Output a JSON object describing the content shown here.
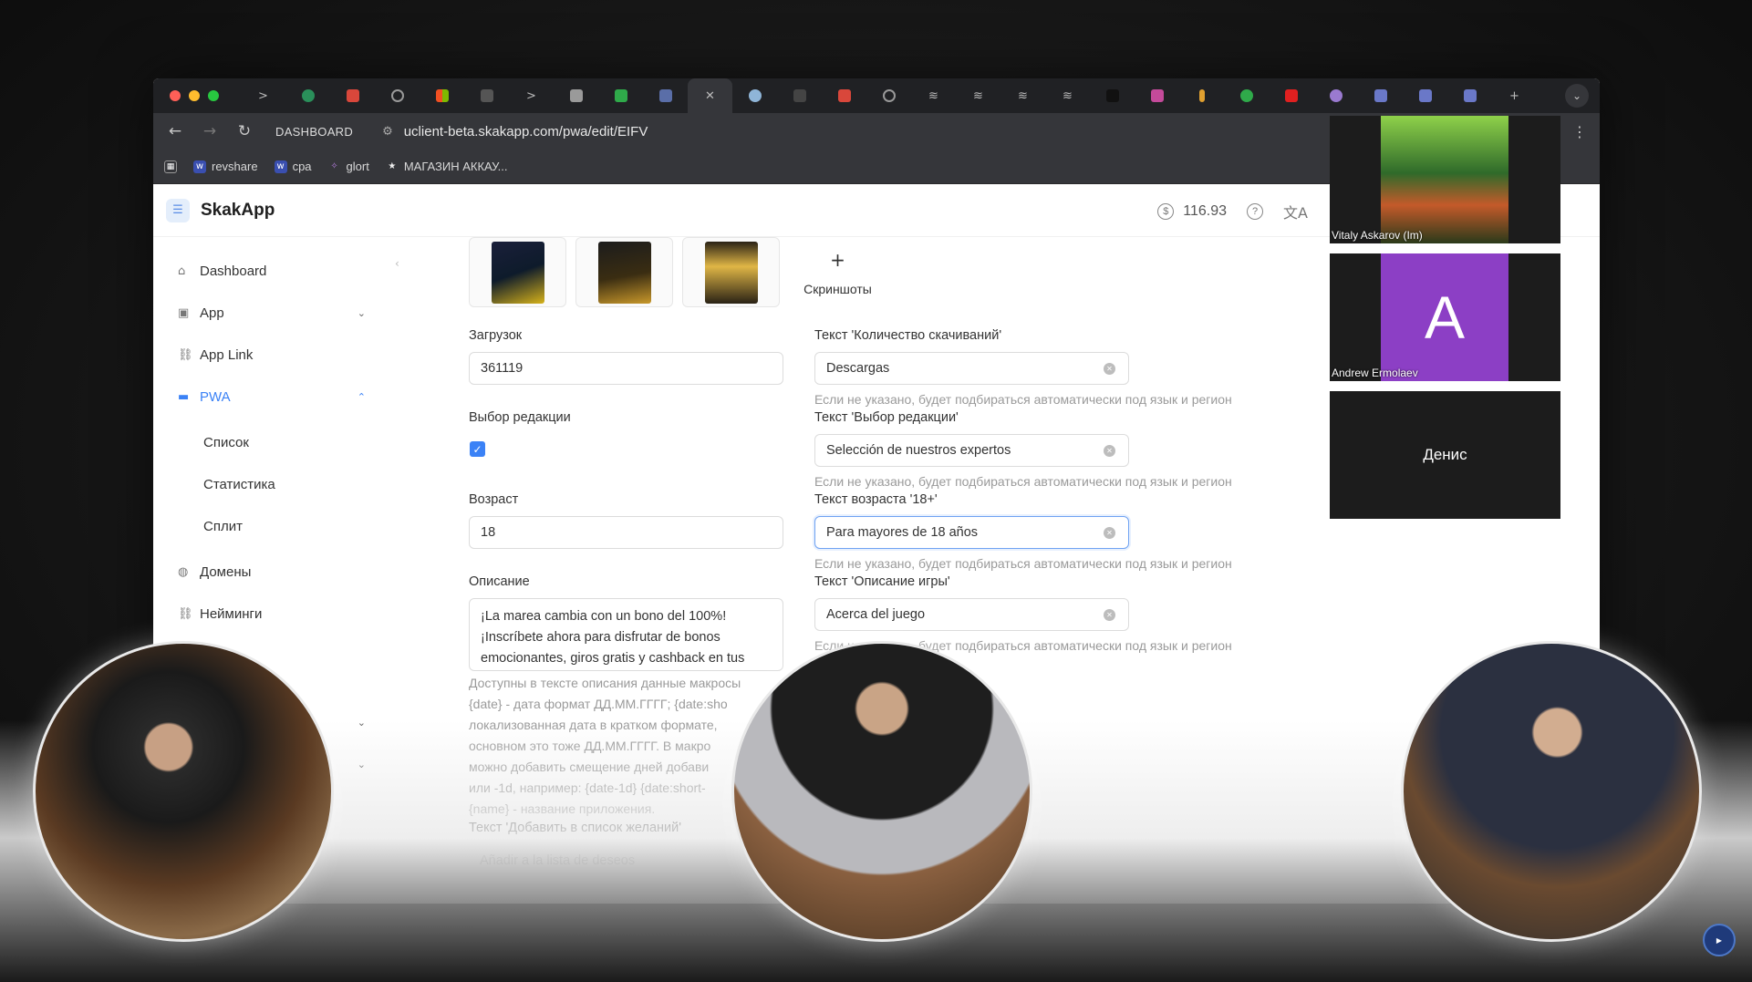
{
  "browser": {
    "address": {
      "back": "←",
      "forward": "→",
      "reload": "↻",
      "dashboard_label": "DASHBOARD",
      "url": "uclient-beta.skakapp.com/pwa/edit/EIFV"
    },
    "bookmarks": [
      {
        "label": "revshare",
        "icon": "bookmark-revshare-icon"
      },
      {
        "label": "cpa",
        "icon": "bookmark-cpa-icon"
      },
      {
        "label": "glort",
        "icon": "bookmark-glort-icon"
      },
      {
        "label": "МАГАЗИН АККАУ...",
        "icon": "bookmark-star-icon"
      }
    ]
  },
  "app": {
    "name": "SkakApp",
    "balance": "116.93",
    "sidebar": {
      "items": [
        {
          "label": "Dashboard",
          "icon": "home-icon"
        },
        {
          "label": "App",
          "icon": "app-icon"
        },
        {
          "label": "App Link",
          "icon": "link-icon"
        },
        {
          "label": "PWA",
          "icon": "pwa-icon"
        },
        {
          "label": "Домены",
          "icon": "globe-icon"
        },
        {
          "label": "Нейминги",
          "icon": "naming-icon"
        }
      ],
      "pwa_sub": [
        "Список",
        "Статистика",
        "Сплит"
      ]
    },
    "form": {
      "screenshots_add_label": "Скриншоты",
      "downloads_label": "Загрузок",
      "downloads_value": "361119",
      "downloads_text_label": "Текст 'Количество скачиваний'",
      "downloads_text_value": "Descargas",
      "hint": "Если не указано, будет подбираться автоматически под язык и регион",
      "editors_choice_label": "Выбор редакции",
      "editors_choice_checked": true,
      "editors_text_label": "Текст 'Выбор редакции'",
      "editors_text_value": "Selección de nuestros expertos",
      "age_label": "Возраст",
      "age_value": "18",
      "age_text_label": "Текст возраста '18+'",
      "age_text_value": "Para mayores de 18 años",
      "description_label": "Описание",
      "description_lines": [
        "¡La marea cambia con un bono del 100%!",
        "¡Inscríbete ahora para disfrutar de bonos",
        "emocionantes, giros gratis y cashback en tus"
      ],
      "game_desc_label": "Текст 'Описание игры'",
      "game_desc_value": "Acerca del juego",
      "hint_partial": "Если не указано, будет подбираться автоматически под язык и регион",
      "macro_lines": [
        "Доступны в тексте описания данные макросы",
        "{date} - дата формат ДД.ММ.ГГГГ; {date:sho",
        "локализованная дата в кратком формате,",
        "основном это тоже ДД.ММ.ГГГГ. В макро",
        "можно добавить смещение дней добави",
        "или -1d, например: {date-1d} {date:short-",
        "{name} - название приложения."
      ],
      "wishlist_label": "Текст 'Добавить в список желаний'",
      "wishlist_placeholder": "Añadir a la lista de deseos"
    }
  },
  "call": {
    "participants": [
      {
        "name": "Vitaly Askarov (Im)"
      },
      {
        "name": "Andrew Ermolaev",
        "initial": "A"
      },
      {
        "name": "Денис"
      }
    ]
  },
  "colors": {
    "accent": "#3b82f6",
    "avatar_purple": "#8c3fc5"
  }
}
